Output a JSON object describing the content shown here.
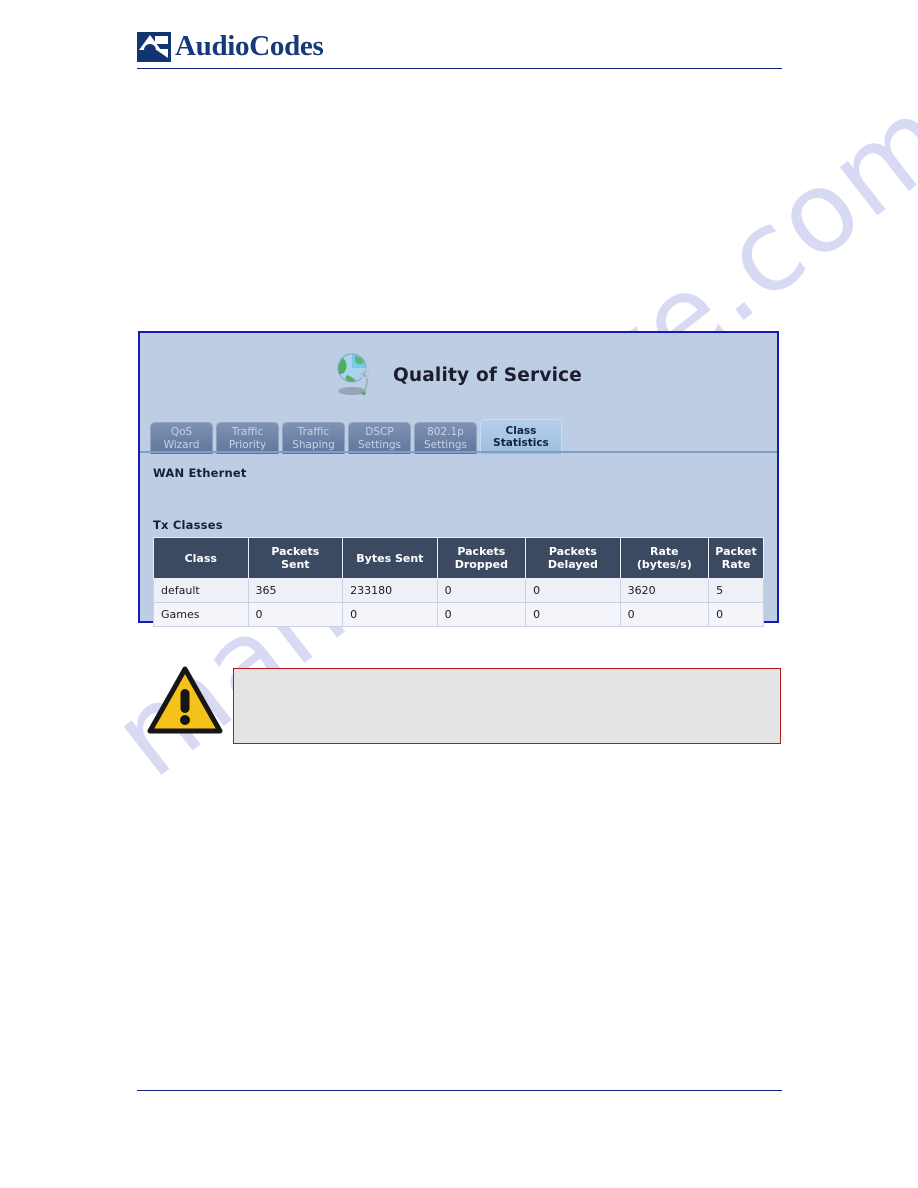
{
  "document": {
    "brand": "AudioCodes",
    "logo_icon": "audiocodes-logo-mark",
    "watermark": "manualshive.com"
  },
  "panel": {
    "title": "Quality of Service",
    "title_icon": "globe-with-magnifier-icon",
    "tabs": [
      {
        "line1": "QoS",
        "line2": "Wizard",
        "active": false
      },
      {
        "line1": "Traffic",
        "line2": "Priority",
        "active": false
      },
      {
        "line1": "Traffic",
        "line2": "Shaping",
        "active": false
      },
      {
        "line1": "DSCP",
        "line2": "Settings",
        "active": false
      },
      {
        "line1": "802.1p",
        "line2": "Settings",
        "active": false
      },
      {
        "line1": "Class",
        "line2": "Statistics",
        "active": true
      }
    ],
    "interface_label": "WAN Ethernet",
    "table_caption": "Tx Classes",
    "table": {
      "columns": [
        {
          "line1": "Class",
          "line2": ""
        },
        {
          "line1": "Packets",
          "line2": "Sent"
        },
        {
          "line1": "Bytes Sent",
          "line2": ""
        },
        {
          "line1": "Packets",
          "line2": "Dropped"
        },
        {
          "line1": "Packets",
          "line2": "Delayed"
        },
        {
          "line1": "Rate",
          "line2": "(bytes/s)"
        },
        {
          "line1": "Packet",
          "line2": "Rate"
        }
      ],
      "rows": [
        {
          "class": "default",
          "packets_sent": "365",
          "bytes_sent": "233180",
          "packets_dropped": "0",
          "packets_delayed": "0",
          "rate_bytes_s": "3620",
          "packet_rate": "5"
        },
        {
          "class": "Games",
          "packets_sent": "0",
          "bytes_sent": "0",
          "packets_dropped": "0",
          "packets_delayed": "0",
          "rate_bytes_s": "0",
          "packet_rate": "0"
        }
      ]
    }
  },
  "note": {
    "icon": "warning-triangle-icon",
    "text": "",
    "border_color": "#b01919",
    "fill_color": "#e4e4e4"
  },
  "colors": {
    "brand_navy": "#143a7a",
    "panel_border": "#1a1ab0",
    "panel_bg": "#bdcde4",
    "table_header": "#3b4a61",
    "tab_active_bg": "#a9c6e4",
    "tab_inactive_bg": "#6c82a6",
    "warning_yellow": "#f5c21b"
  }
}
